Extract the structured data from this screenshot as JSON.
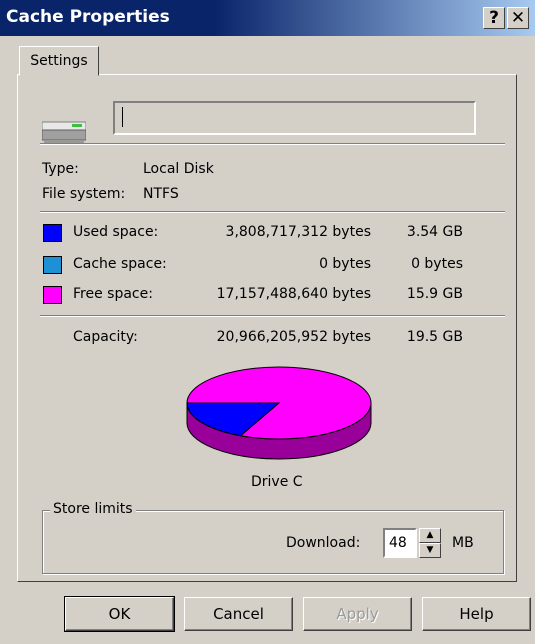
{
  "window": {
    "title": "Cache Properties",
    "help_glyph": "?",
    "close_glyph": "✕"
  },
  "tabs": [
    {
      "label": "Settings",
      "selected": true
    }
  ],
  "drive": {
    "name_value": "",
    "type_label": "Type:",
    "type_value": "Local Disk",
    "fs_label": "File system:",
    "fs_value": "NTFS"
  },
  "space": {
    "used": {
      "label": "Used space:",
      "bytes": "3,808,717,312 bytes",
      "size": "3.54 GB",
      "color": "#0000ff"
    },
    "cache": {
      "label": "Cache space:",
      "bytes": "0 bytes",
      "size": "0 bytes",
      "color": "#1e90d6"
    },
    "free": {
      "label": "Free space:",
      "bytes": "17,157,488,640 bytes",
      "size": "15.9 GB",
      "color": "#ff00ff"
    },
    "capacity": {
      "label": "Capacity:",
      "bytes": "20,966,205,952 bytes",
      "size": "19.5 GB"
    }
  },
  "chart_data": {
    "type": "pie",
    "title": "",
    "categories": [
      "Used space",
      "Cache space",
      "Free space"
    ],
    "values": [
      3808717312,
      0,
      17157488640
    ],
    "colors": [
      "#0000ff",
      "#1e90d6",
      "#ff00ff"
    ]
  },
  "drive_caption": "Drive C",
  "store_limits": {
    "title": "Store limits",
    "download_label": "Download:",
    "download_value": "48",
    "unit": "MB"
  },
  "buttons": {
    "ok": "OK",
    "cancel": "Cancel",
    "apply": "Apply",
    "help": "Help"
  }
}
